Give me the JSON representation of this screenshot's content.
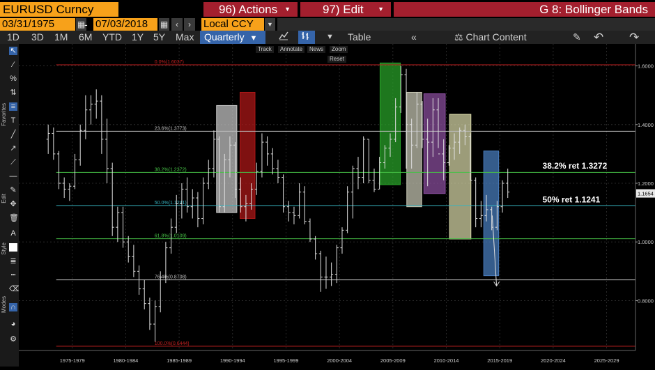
{
  "header": {
    "ticker": "EURUSD Curncy",
    "actions_label": "96) Actions",
    "edit_label": "97) Edit",
    "function_title": "G 8: Bollinger Bands",
    "undo_icon": "undo-icon",
    "redo_icon": "redo-icon"
  },
  "dates": {
    "start": "03/31/1975",
    "separator": "-",
    "end": "07/03/2018",
    "currency": "Local CCY"
  },
  "toolbar": {
    "periods": [
      "1D",
      "3D",
      "1M",
      "6M",
      "YTD",
      "1Y",
      "5Y",
      "Max"
    ],
    "frequency": "Quarterly",
    "table_label": "Table",
    "chart_content_label": "Chart Content"
  },
  "chart_tools": {
    "track": "Track",
    "annotate": "Annotate",
    "news": "News",
    "zoom": "Zoom",
    "reset": "Reset"
  },
  "sidebar": {
    "favorites_label": "Favorites",
    "edit_label": "Edit",
    "style_label": "Style",
    "modes_label": "Modes"
  },
  "chart_data": {
    "type": "candlestick",
    "title": "",
    "xlabel": "",
    "ylabel": "",
    "ylim": [
      0.63,
      1.675
    ],
    "yticks": [
      0.8,
      1.0,
      1.2,
      1.4,
      1.6
    ],
    "ytick_labels": [
      "0.8000",
      "1.0000",
      "1.2000",
      "1.4000",
      "1.6000"
    ],
    "x_categories": [
      "1975-1979",
      "1980-1984",
      "1985-1989",
      "1990-1994",
      "1995-1999",
      "2000-2004",
      "2005-2009",
      "2010-2014",
      "2015-2019",
      "2020-2024",
      "2025-2029"
    ],
    "last_price": "1.1654",
    "last_price_value": 1.1654,
    "series": [
      {
        "start_year": 1975.25,
        "points": [
          [
            1975.25,
            1.35,
            1.4,
            1.3,
            1.37
          ],
          [
            1975.75,
            1.37,
            1.39,
            1.28,
            1.3
          ],
          [
            1976.25,
            1.3,
            1.31,
            1.18,
            1.2
          ],
          [
            1976.75,
            1.2,
            1.22,
            1.15,
            1.18
          ],
          [
            1977.25,
            1.18,
            1.2,
            1.14,
            1.19
          ],
          [
            1977.75,
            1.19,
            1.3,
            1.18,
            1.28
          ],
          [
            1978.25,
            1.28,
            1.4,
            1.26,
            1.38
          ],
          [
            1978.75,
            1.38,
            1.5,
            1.35,
            1.45
          ],
          [
            1979.25,
            1.45,
            1.5,
            1.4,
            1.47
          ],
          [
            1979.75,
            1.47,
            1.52,
            1.42,
            1.48
          ],
          [
            1980.25,
            1.48,
            1.5,
            1.3,
            1.35
          ],
          [
            1980.75,
            1.35,
            1.42,
            1.2,
            1.25
          ],
          [
            1981.25,
            1.25,
            1.27,
            1.02,
            1.05
          ],
          [
            1981.75,
            1.05,
            1.12,
            1.0,
            1.1
          ],
          [
            1982.25,
            1.1,
            1.12,
            0.98,
            1.0
          ],
          [
            1982.75,
            1.0,
            1.02,
            0.93,
            0.95
          ],
          [
            1983.25,
            0.95,
            0.99,
            0.88,
            0.9
          ],
          [
            1983.75,
            0.9,
            0.92,
            0.82,
            0.84
          ],
          [
            1984.25,
            0.84,
            0.87,
            0.77,
            0.79
          ],
          [
            1984.75,
            0.79,
            0.81,
            0.7,
            0.72
          ],
          [
            1985.25,
            0.72,
            0.8,
            0.66,
            0.78
          ],
          [
            1985.75,
            0.78,
            0.9,
            0.76,
            0.88
          ],
          [
            1986.25,
            0.88,
            1.0,
            0.86,
            0.98
          ],
          [
            1986.75,
            0.98,
            1.08,
            0.96,
            1.05
          ],
          [
            1987.25,
            1.05,
            1.16,
            1.03,
            1.13
          ],
          [
            1987.75,
            1.13,
            1.2,
            1.08,
            1.18
          ],
          [
            1988.25,
            1.18,
            1.22,
            1.1,
            1.12
          ],
          [
            1988.75,
            1.12,
            1.18,
            1.08,
            1.15
          ],
          [
            1989.25,
            1.15,
            1.17,
            1.05,
            1.08
          ],
          [
            1989.75,
            1.08,
            1.22,
            1.06,
            1.2
          ],
          [
            1990.25,
            1.2,
            1.28,
            1.18,
            1.25
          ],
          [
            1990.75,
            1.25,
            1.38,
            1.22,
            1.35
          ],
          [
            1991.25,
            1.35,
            1.36,
            1.1,
            1.12
          ],
          [
            1991.75,
            1.12,
            1.3,
            1.1,
            1.28
          ],
          [
            1992.25,
            1.28,
            1.36,
            1.22,
            1.33
          ],
          [
            1992.75,
            1.33,
            1.34,
            1.15,
            1.18
          ],
          [
            1993.25,
            1.18,
            1.22,
            1.1,
            1.12
          ],
          [
            1993.75,
            1.12,
            1.16,
            1.07,
            1.13
          ],
          [
            1994.25,
            1.13,
            1.2,
            1.11,
            1.18
          ],
          [
            1994.75,
            1.18,
            1.27,
            1.16,
            1.24
          ],
          [
            1995.25,
            1.24,
            1.37,
            1.22,
            1.34
          ],
          [
            1995.75,
            1.34,
            1.36,
            1.26,
            1.3
          ],
          [
            1996.25,
            1.3,
            1.32,
            1.23,
            1.25
          ],
          [
            1996.75,
            1.25,
            1.28,
            1.2,
            1.22
          ],
          [
            1997.25,
            1.22,
            1.23,
            1.1,
            1.12
          ],
          [
            1997.75,
            1.12,
            1.14,
            1.07,
            1.1
          ],
          [
            1998.25,
            1.1,
            1.12,
            1.06,
            1.09
          ],
          [
            1998.75,
            1.09,
            1.2,
            1.08,
            1.17
          ],
          [
            1999.25,
            1.17,
            1.19,
            1.06,
            1.07
          ],
          [
            1999.75,
            1.07,
            1.08,
            1.0,
            1.01
          ],
          [
            2000.25,
            1.01,
            1.02,
            0.94,
            0.96
          ],
          [
            2000.75,
            0.96,
            0.97,
            0.83,
            0.88
          ],
          [
            2001.25,
            0.88,
            0.95,
            0.84,
            0.88
          ],
          [
            2001.75,
            0.88,
            0.93,
            0.85,
            0.89
          ],
          [
            2002.25,
            0.89,
            0.99,
            0.86,
            0.98
          ],
          [
            2002.75,
            0.98,
            1.05,
            0.96,
            1.04
          ],
          [
            2003.25,
            1.04,
            1.19,
            1.03,
            1.17
          ],
          [
            2003.75,
            1.17,
            1.26,
            1.08,
            1.25
          ],
          [
            2004.25,
            1.25,
            1.29,
            1.18,
            1.22
          ],
          [
            2004.75,
            1.22,
            1.36,
            1.2,
            1.35
          ],
          [
            2005.25,
            1.35,
            1.35,
            1.2,
            1.21
          ],
          [
            2005.75,
            1.21,
            1.25,
            1.17,
            1.18
          ],
          [
            2006.25,
            1.18,
            1.29,
            1.18,
            1.27
          ],
          [
            2006.75,
            1.27,
            1.33,
            1.25,
            1.32
          ],
          [
            2007.25,
            1.32,
            1.37,
            1.29,
            1.35
          ],
          [
            2007.75,
            1.35,
            1.49,
            1.34,
            1.46
          ],
          [
            2008.25,
            1.46,
            1.6,
            1.44,
            1.57
          ],
          [
            2008.75,
            1.57,
            1.59,
            1.25,
            1.4
          ],
          [
            2009.25,
            1.4,
            1.42,
            1.25,
            1.33
          ],
          [
            2009.75,
            1.33,
            1.51,
            1.32,
            1.47
          ],
          [
            2010.25,
            1.47,
            1.48,
            1.32,
            1.35
          ],
          [
            2010.75,
            1.35,
            1.42,
            1.19,
            1.34
          ],
          [
            2011.25,
            1.34,
            1.49,
            1.29,
            1.45
          ],
          [
            2011.75,
            1.45,
            1.49,
            1.32,
            1.3
          ],
          [
            2012.25,
            1.3,
            1.35,
            1.21,
            1.27
          ],
          [
            2012.75,
            1.27,
            1.33,
            1.26,
            1.32
          ],
          [
            2013.25,
            1.32,
            1.37,
            1.28,
            1.34
          ],
          [
            2013.75,
            1.34,
            1.39,
            1.3,
            1.38
          ],
          [
            2014.25,
            1.38,
            1.4,
            1.33,
            1.36
          ],
          [
            2014.75,
            1.36,
            1.37,
            1.21,
            1.21
          ],
          [
            2015.25,
            1.21,
            1.22,
            1.05,
            1.08
          ],
          [
            2015.75,
            1.08,
            1.14,
            1.05,
            1.09
          ],
          [
            2016.25,
            1.09,
            1.16,
            1.07,
            1.11
          ],
          [
            2016.75,
            1.11,
            1.12,
            1.04,
            1.05
          ],
          [
            2017.25,
            1.05,
            1.14,
            1.04,
            1.12
          ],
          [
            2017.75,
            1.12,
            1.21,
            1.1,
            1.2
          ],
          [
            2018.25,
            1.2,
            1.25,
            1.15,
            1.17
          ]
        ]
      }
    ],
    "fib_levels": [
      {
        "label": "0.0%(1.6037)",
        "value": 1.6037,
        "color": "#c42020"
      },
      {
        "label": "23.6%(1.3773)",
        "value": 1.3773,
        "color": "#bdbdbd"
      },
      {
        "label": "38.2%(1.2372)",
        "value": 1.2372,
        "color": "#46c146"
      },
      {
        "label": "50.0%(1.1241)",
        "value": 1.1241,
        "color": "#36b3c0"
      },
      {
        "label": "61.8%(1.0109)",
        "value": 1.0109,
        "color": "#46c146"
      },
      {
        "label": "76.4%(0.8708)",
        "value": 0.8708,
        "color": "#bdbdbd"
      },
      {
        "label": "100.0%(0.6444)",
        "value": 0.6444,
        "color": "#c42020"
      }
    ],
    "annotations": [
      {
        "text": "38.2% ret 1.3272",
        "x": 2021.5,
        "y": 1.25
      },
      {
        "text": "50% ret 1.1241",
        "x": 2021.5,
        "y": 1.135
      }
    ],
    "boxes": [
      {
        "x0": 1991.0,
        "x1": 1992.9,
        "y0": 1.1,
        "y1": 1.465,
        "color": "#c8c8c8"
      },
      {
        "x0": 1993.2,
        "x1": 1994.6,
        "y0": 1.08,
        "y1": 1.51,
        "color": "#b01818"
      },
      {
        "x0": 2006.3,
        "x1": 2008.2,
        "y0": 1.195,
        "y1": 1.61,
        "color": "#2aa52a"
      },
      {
        "x0": 2008.8,
        "x1": 2010.2,
        "y0": 1.12,
        "y1": 1.51,
        "color": "#c8c8b4"
      },
      {
        "x0": 2010.4,
        "x1": 2012.4,
        "y0": 1.165,
        "y1": 1.505,
        "color": "#8c4fa0"
      },
      {
        "x0": 2012.8,
        "x1": 2014.8,
        "y0": 1.01,
        "y1": 1.435,
        "color": "#d8d8a8"
      },
      {
        "x0": 2016.0,
        "x1": 2017.4,
        "y0": 0.885,
        "y1": 1.31,
        "color": "#4a7fc0"
      }
    ],
    "projection": {
      "x0": 2016.8,
      "y0": 1.09,
      "x1": 2017.2,
      "y1": 0.85
    }
  }
}
